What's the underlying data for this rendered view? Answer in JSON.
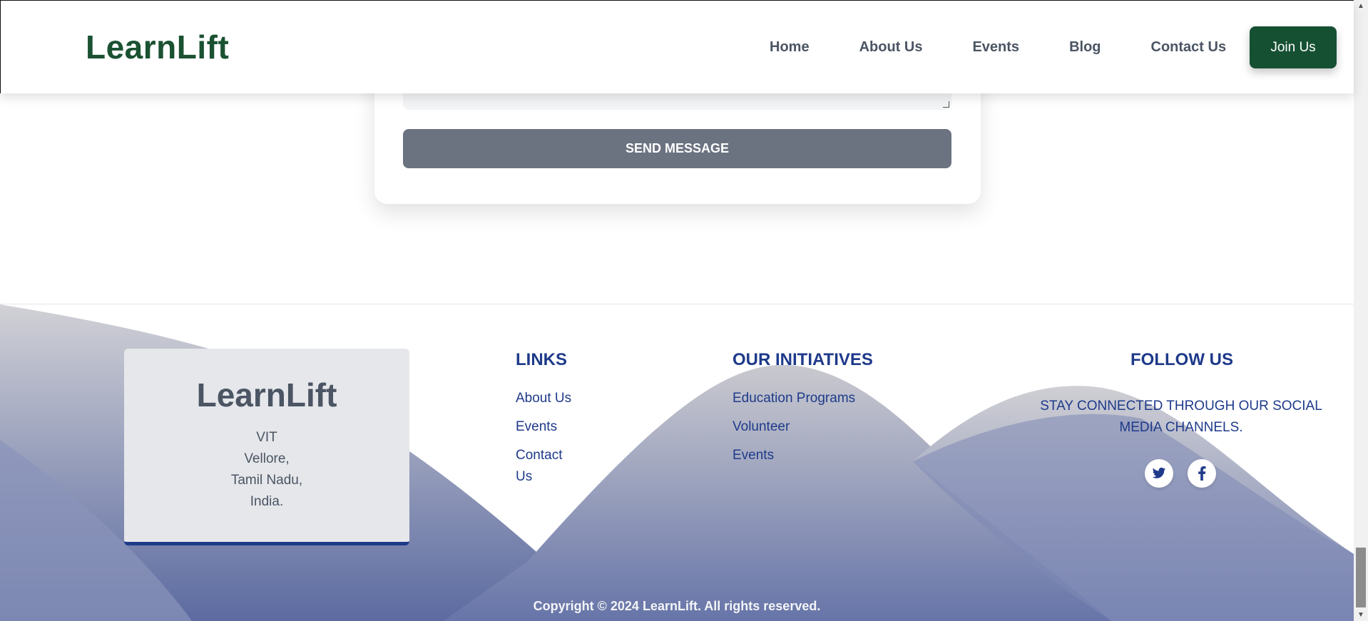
{
  "header": {
    "logo": "LearnLift",
    "nav": [
      "Home",
      "About Us",
      "Events",
      "Blog",
      "Contact Us"
    ],
    "join_label": "Join Us"
  },
  "form": {
    "send_label": "SEND MESSAGE"
  },
  "footer": {
    "brand": {
      "title": "LearnLift",
      "address": [
        "VIT",
        "Vellore,",
        "Tamil Nadu,",
        "India."
      ]
    },
    "links": {
      "title": "LINKS",
      "items": [
        "About Us",
        "Events",
        "Contact",
        "Us"
      ]
    },
    "initiatives": {
      "title": "OUR INITIATIVES",
      "items": [
        "Education Programs",
        "Volunteer",
        "Events"
      ]
    },
    "follow": {
      "title": "FOLLOW US",
      "text_line1": "STAY CONNECTED THROUGH OUR SOCIAL",
      "text_line2": "MEDIA CHANNELS.",
      "icons": [
        "twitter-icon",
        "facebook-icon"
      ]
    },
    "copyright": "Copyright © 2024 LearnLift. All rights reserved."
  },
  "colors": {
    "brand_green": "#165033",
    "footer_blue": "#1e3a8a",
    "send_gray": "#6b7280"
  }
}
